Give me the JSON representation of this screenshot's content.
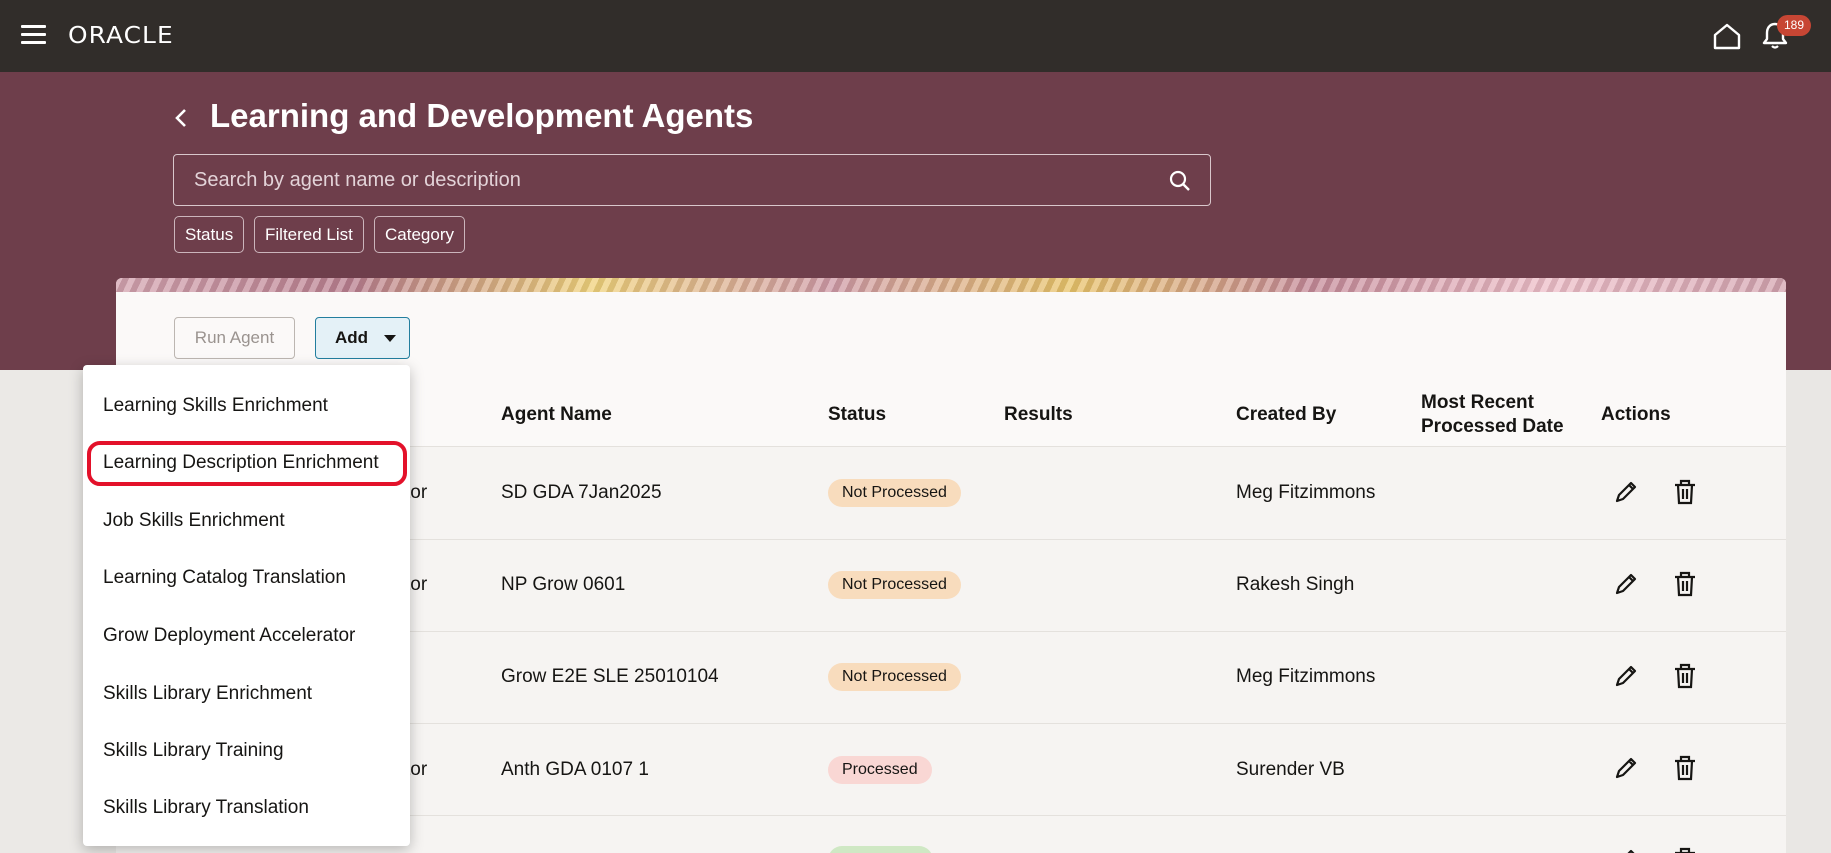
{
  "app": {
    "logo": "ORACLE",
    "notification_count": "189"
  },
  "header": {
    "title": "Learning and Development Agents"
  },
  "search": {
    "placeholder": "Search by agent name or description"
  },
  "filters": [
    "Status",
    "Filtered List",
    "Category"
  ],
  "toolbar": {
    "run_label": "Run Agent",
    "add_label": "Add"
  },
  "table": {
    "columns": [
      "Agent Name",
      "Status",
      "Results",
      "Created By",
      "Most Recent",
      "Processed Date",
      "Actions"
    ],
    "rows": [
      {
        "type_fragment": "tor",
        "agent_name": "SD GDA 7Jan2025",
        "status": "Not Processed",
        "created_by": "Meg Fitzimmons"
      },
      {
        "type_fragment": "tor",
        "agent_name": "NP Grow 0601",
        "status": "Not Processed",
        "created_by": "Rakesh Singh"
      },
      {
        "type_fragment": "",
        "agent_name": "Grow E2E SLE 25010104",
        "status": "Not Processed",
        "created_by": "Meg Fitzimmons"
      },
      {
        "type_fragment": "tor",
        "agent_name": "Anth GDA 0107 1",
        "status": "Processed",
        "created_by": "Surender VB"
      }
    ]
  },
  "status_colors": {
    "not_processed": "#f8dcbd",
    "processed": "#f9d7d4",
    "partial": "#cfe8c4"
  },
  "add_menu": {
    "items": [
      "Learning Skills Enrichment",
      "Learning Description Enrichment",
      "Job Skills Enrichment",
      "Learning Catalog Translation",
      "Grow Deployment Accelerator",
      "Skills Library Enrichment",
      "Skills Library Training",
      "Skills Library Translation"
    ],
    "highlighted": "Learning Description Enrichment"
  },
  "icons": [
    "hamburger-icon",
    "home-icon",
    "bell-icon",
    "back-chevron-icon",
    "search-icon",
    "caret-down-icon",
    "edit-pencil-icon",
    "trash-icon"
  ],
  "colors": {
    "topbar": "#312d2a",
    "hero": "#6e3e4b",
    "highlight": "#e3112a"
  }
}
